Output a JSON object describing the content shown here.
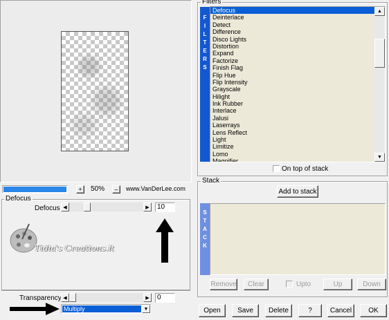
{
  "preview": {
    "zoom_label": "50%",
    "zoom_plus": "+",
    "zoom_minus": "–",
    "website": "www.VanDerLee.com"
  },
  "defocus_group": {
    "title": "Defocus",
    "slider_label": "Defocus",
    "slider_value": "10",
    "slider_fraction": 0.1
  },
  "watermark": {
    "text": "Tidia's Creations.it"
  },
  "transparency": {
    "label": "Transparency",
    "value": "0",
    "blend_mode": "Multiply"
  },
  "filters_group": {
    "title": "Filters",
    "side_letters": [
      "F",
      "I",
      "L",
      "T",
      "E",
      "R",
      "S"
    ],
    "items": [
      "Defocus",
      "Deinterlace",
      "Detect",
      "Difference",
      "Disco Lights",
      "Distortion",
      "Expand",
      "Factorize",
      "Finish Flag",
      "Flip Hue",
      "Flip Intensity",
      "Grayscale",
      "Hilight",
      "Ink Rubber",
      "Interlace",
      "Jalusi",
      "Laserrays",
      "Lens Reflect",
      "Light",
      "Limitize",
      "Lomo",
      "Magnifier"
    ],
    "selected_index": 0,
    "on_top_label": "On top of stack",
    "on_top_checked": false
  },
  "stack_group": {
    "title": "Stack",
    "add_label": "Add to stack",
    "side_letters": [
      "S",
      "T",
      "A",
      "C",
      "K"
    ],
    "remove_label": "Remove",
    "clear_label": "Clear",
    "upto_label": "Upto",
    "up_label": "Up",
    "down_label": "Down"
  },
  "dialog_buttons": {
    "open": "Open",
    "save": "Save",
    "delete": "Delete",
    "help": "?",
    "cancel": "Cancel",
    "ok": "OK"
  },
  "colors": {
    "accent_blue": "#0a5fd6",
    "stack_side": "#6f8fe0",
    "list_bg": "#ece9d8",
    "stack_bg": "#ece9d8"
  }
}
